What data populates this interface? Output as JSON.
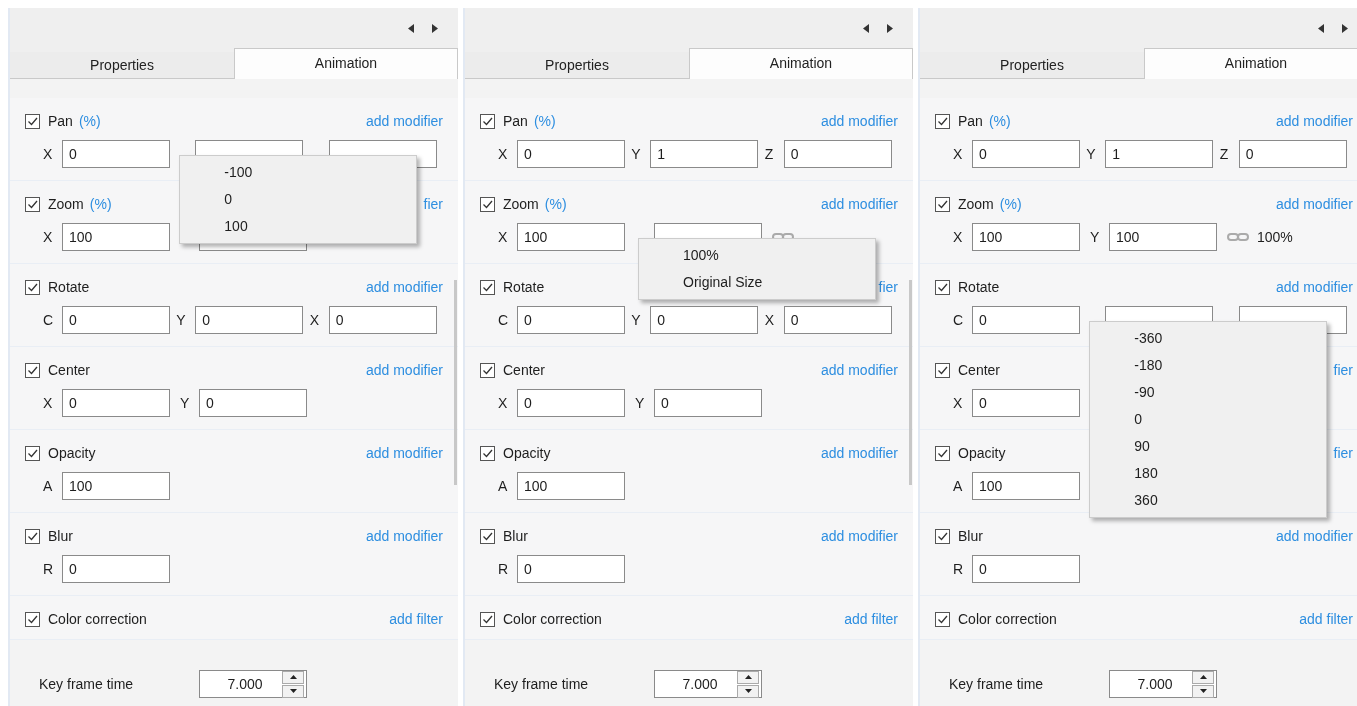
{
  "panels": [
    {
      "tabs": [
        {
          "label": "Properties",
          "selected": false
        },
        {
          "label": "Animation",
          "selected": true
        }
      ],
      "sections": [
        {
          "label": "Pan",
          "unit": "(%)",
          "checked": true,
          "action": "add modifier",
          "fields": [
            {
              "label": "X",
              "value": "0"
            },
            {
              "kind": "number",
              "menu": {
                "items": [
                  "-100",
                  "0",
                  "100"
                ]
              }
            },
            {
              "kind": "number"
            }
          ]
        },
        {
          "label": "Zoom",
          "unit": "(%)",
          "checked": true,
          "action": "fier",
          "fields": [
            {
              "label": "X",
              "value": "100"
            },
            {
              "kind": "number"
            }
          ]
        },
        {
          "label": "Rotate",
          "checked": true,
          "action": "add modifier",
          "fields": [
            {
              "label": "C",
              "value": "0"
            },
            {
              "label": "Y",
              "value": "0"
            },
            {
              "label": "X",
              "value": "0"
            }
          ]
        },
        {
          "label": "Center",
          "checked": true,
          "action": "add modifier",
          "fields": [
            {
              "label": "X",
              "value": "0"
            },
            {
              "label": "Y",
              "value": "0"
            }
          ]
        },
        {
          "label": "Opacity",
          "checked": true,
          "action": "add modifier",
          "fields": [
            {
              "label": "A",
              "value": "100"
            }
          ]
        },
        {
          "label": "Blur",
          "checked": true,
          "action": "add modifier",
          "fields": [
            {
              "label": "R",
              "value": "0"
            }
          ]
        },
        {
          "label": "Color correction",
          "checked": true,
          "action": "add filter"
        }
      ],
      "key_frame": {
        "label": "Key frame time",
        "value": "7.000"
      }
    },
    {
      "tabs": [
        {
          "label": "Properties",
          "selected": false
        },
        {
          "label": "Animation",
          "selected": true
        }
      ],
      "sections": [
        {
          "label": "Pan",
          "unit": "(%)",
          "checked": true,
          "action": "add modifier",
          "fields": [
            {
              "label": "X",
              "value": "0"
            },
            {
              "label": "Y",
              "value": "1"
            },
            {
              "label": "Z",
              "value": "0"
            }
          ]
        },
        {
          "label": "Zoom",
          "unit": "(%)",
          "checked": true,
          "action": "add modifier",
          "fields": [
            {
              "label": "X",
              "value": "100"
            },
            {
              "kind": "number",
              "menu": {
                "items": [
                  "100%",
                  "Original Size"
                ]
              }
            }
          ],
          "chain": true
        },
        {
          "label": "Rotate",
          "checked": true,
          "action": "fier",
          "fields": [
            {
              "label": "C",
              "value": "0"
            },
            {
              "label": "Y",
              "value": "0"
            },
            {
              "label": "X",
              "value": "0"
            }
          ]
        },
        {
          "label": "Center",
          "checked": true,
          "action": "add modifier",
          "fields": [
            {
              "label": "X",
              "value": "0"
            },
            {
              "label": "Y",
              "value": "0"
            }
          ]
        },
        {
          "label": "Opacity",
          "checked": true,
          "action": "add modifier",
          "fields": [
            {
              "label": "A",
              "value": "100"
            }
          ]
        },
        {
          "label": "Blur",
          "checked": true,
          "action": "add modifier",
          "fields": [
            {
              "label": "R",
              "value": "0"
            }
          ]
        },
        {
          "label": "Color correction",
          "checked": true,
          "action": "add filter"
        }
      ],
      "key_frame": {
        "label": "Key frame time",
        "value": "7.000"
      }
    },
    {
      "tabs": [
        {
          "label": "Properties",
          "selected": false
        },
        {
          "label": "Animation",
          "selected": true
        }
      ],
      "sections": [
        {
          "label": "Pan",
          "unit": "(%)",
          "checked": true,
          "action": "add modifier",
          "fields": [
            {
              "label": "X",
              "value": "0"
            },
            {
              "label": "Y",
              "value": "1"
            },
            {
              "label": "Z",
              "value": "0"
            }
          ]
        },
        {
          "label": "Zoom",
          "unit": "(%)",
          "checked": true,
          "action": "add modifier",
          "fields": [
            {
              "label": "X",
              "value": "100"
            },
            {
              "label": "Y",
              "value": "100"
            }
          ],
          "chain": true,
          "reading": "100%"
        },
        {
          "label": "Rotate",
          "checked": true,
          "action": "add modifier",
          "fields": [
            {
              "label": "C",
              "value": "0"
            },
            {
              "kind": "number",
              "menu": {
                "items": [
                  "-360",
                  "-180",
                  "-90",
                  "0",
                  "90",
                  "180",
                  "360"
                ]
              }
            },
            {
              "kind": "number"
            }
          ]
        },
        {
          "label": "Center",
          "checked": true,
          "action": "fier",
          "fields": [
            {
              "label": "X",
              "value": "0"
            }
          ]
        },
        {
          "label": "Opacity",
          "checked": true,
          "action": "fier",
          "fields": [
            {
              "label": "A",
              "value": "100"
            }
          ]
        },
        {
          "label": "Blur",
          "checked": true,
          "action": "add modifier",
          "fields": [
            {
              "label": "R",
              "value": "0"
            }
          ]
        },
        {
          "label": "Color correction",
          "checked": true,
          "action": "add filter"
        }
      ],
      "key_frame": {
        "label": "Key frame time",
        "value": "7.000"
      }
    }
  ]
}
